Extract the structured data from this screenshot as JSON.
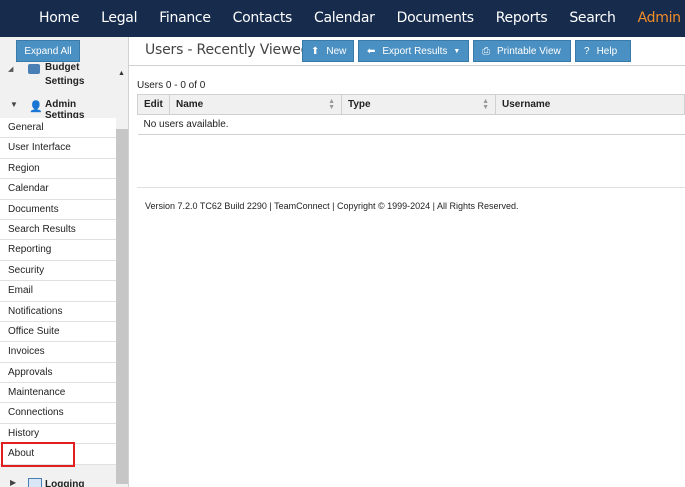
{
  "nav": {
    "items": [
      {
        "label": "Home"
      },
      {
        "label": "Legal"
      },
      {
        "label": "Finance"
      },
      {
        "label": "Contacts"
      },
      {
        "label": "Calendar"
      },
      {
        "label": "Documents"
      },
      {
        "label": "Reports"
      },
      {
        "label": "Search"
      },
      {
        "label": "Admin",
        "active": true
      }
    ],
    "active_color": "#f28c28",
    "bar_color": "#172b4d"
  },
  "sidebar": {
    "expand_all_label": "Expand All",
    "budget_label_1": "Budget",
    "budget_label_2": "Settings",
    "admin_settings_label": "Admin Settings",
    "items": [
      {
        "label": "General"
      },
      {
        "label": "User Interface"
      },
      {
        "label": "Region"
      },
      {
        "label": "Calendar"
      },
      {
        "label": "Documents"
      },
      {
        "label": "Search Results"
      },
      {
        "label": "Reporting"
      },
      {
        "label": "Security"
      },
      {
        "label": "Email"
      },
      {
        "label": "Notifications"
      },
      {
        "label": "Office Suite"
      },
      {
        "label": "Invoices"
      },
      {
        "label": "Approvals"
      },
      {
        "label": "Maintenance"
      },
      {
        "label": "Connections"
      },
      {
        "label": "History"
      },
      {
        "label": "About",
        "highlighted": true
      }
    ],
    "logging_label": "Logging",
    "highlight_color": "#e02020"
  },
  "main": {
    "title": "Users - Recently Viewed",
    "buttons": {
      "new": "New",
      "export": "Export Results",
      "printable": "Printable View",
      "help": "Help"
    },
    "count_text": "Users 0 - 0 of 0",
    "columns": [
      "Edit",
      "Name",
      "Type",
      "Username"
    ],
    "empty_text": "No users available.",
    "version_text": "Version 7.2.0 TC62 Build 2290 | TeamConnect | Copyright © 1999-2024 | All Rights Reserved.",
    "button_color": "#4a90c2"
  }
}
